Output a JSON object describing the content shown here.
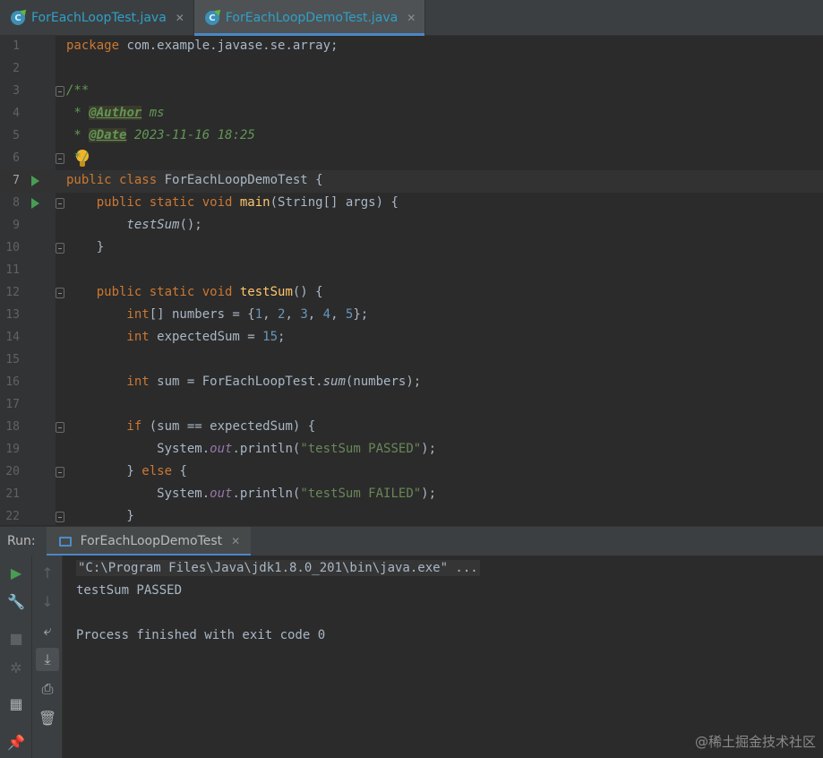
{
  "tabs": [
    {
      "label": "ForEachLoopTest.java",
      "icon": "java-class-icon",
      "active": false
    },
    {
      "label": "ForEachLoopDemoTest.java",
      "icon": "java-class-icon",
      "active": true
    }
  ],
  "editor": {
    "lines": [
      {
        "n": "1"
      },
      {
        "n": "2"
      },
      {
        "n": "3"
      },
      {
        "n": "4"
      },
      {
        "n": "5"
      },
      {
        "n": "6"
      },
      {
        "n": "7"
      },
      {
        "n": "8"
      },
      {
        "n": "9"
      },
      {
        "n": "10"
      },
      {
        "n": "11"
      },
      {
        "n": "12"
      },
      {
        "n": "13"
      },
      {
        "n": "14"
      },
      {
        "n": "15"
      },
      {
        "n": "16"
      },
      {
        "n": "17"
      },
      {
        "n": "18"
      },
      {
        "n": "19"
      },
      {
        "n": "20"
      },
      {
        "n": "21"
      },
      {
        "n": "22"
      }
    ],
    "code": {
      "l1_kw": "package",
      "l1_rest": " com.example.javase.se.array;",
      "l3": "/**",
      "l4_star": " * ",
      "l4_tag": "@Author",
      "l4_val": " ms",
      "l5_star": " * ",
      "l5_tag": "@Date",
      "l5_val": " 2023-11-16 18:25",
      "l6": " */",
      "l7_kw": "public class",
      "l7_rest": " ForEachLoopDemoTest {",
      "l8_kw": "    public static void",
      "l8_fn": " main",
      "l8_rest": "(String[] args) {",
      "l9_fn": "        testSum",
      "l9_rest": "();",
      "l10": "    }",
      "l12_kw": "    public static void",
      "l12_fn": " testSum",
      "l12_rest": "() {",
      "l13_kw": "        int",
      "l13_a": "[] numbers = {",
      "l13_n1": "1",
      "l13_c1": ", ",
      "l13_n2": "2",
      "l13_c2": ", ",
      "l13_n3": "3",
      "l13_c3": ", ",
      "l13_n4": "4",
      "l13_c4": ", ",
      "l13_n5": "5",
      "l13_end": "};",
      "l14_kw": "        int",
      "l14_a": " expectedSum = ",
      "l14_n": "15",
      "l14_end": ";",
      "l16_kw": "        int",
      "l16_a": " sum = ForEachLoopTest.",
      "l16_m": "sum",
      "l16_end": "(numbers);",
      "l18_kw": "        if",
      "l18_rest": " (sum == expectedSum) {",
      "l19_a": "            System.",
      "l19_f": "out",
      "l19_b": ".println(",
      "l19_s": "\"testSum PASSED\"",
      "l19_end": ");",
      "l20_a": "        } ",
      "l20_kw": "else",
      "l20_end": " {",
      "l21_a": "            System.",
      "l21_f": "out",
      "l21_b": ".println(",
      "l21_s": "\"testSum FAILED\"",
      "l21_end": ");",
      "l22": "        }"
    }
  },
  "run": {
    "label": "Run:",
    "tab_label": "ForEachLoopDemoTest",
    "console": [
      "\"C:\\Program Files\\Java\\jdk1.8.0_201\\bin\\java.exe\" ...",
      "testSum PASSED",
      "Process finished with exit code 0"
    ]
  },
  "watermark": "@稀土掘金技术社区",
  "colors": {
    "background": "#2b2b2b",
    "keyword": "#cc7832",
    "doc_comment": "#629755",
    "method": "#ffc66d",
    "number": "#6897bb",
    "string": "#6a8759",
    "field": "#9876aa",
    "accent": "#4a88c7",
    "run_green": "#499c54"
  }
}
